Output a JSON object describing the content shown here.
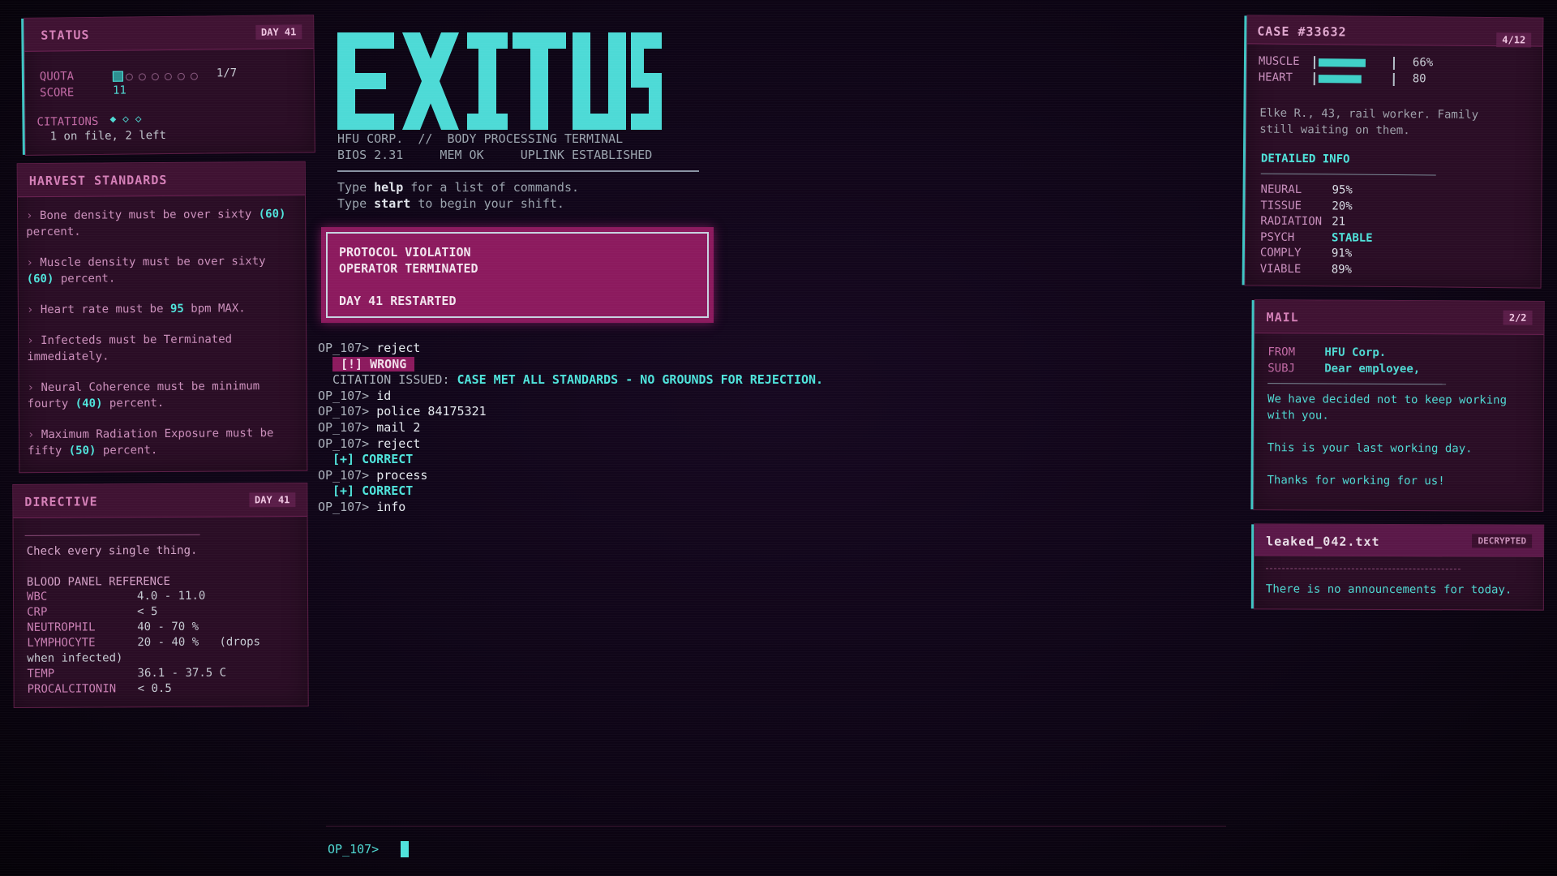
{
  "status": {
    "title": "STATUS",
    "day_badge": "DAY 41",
    "quota_label": "QUOTA",
    "quota_value": "1/7",
    "quota_progress": 1,
    "quota_total": 7,
    "score_label": "SCORE",
    "score_value": "11",
    "citations_label": "CITATIONS",
    "citations_icons": "◆ ◇ ◇",
    "citations_note": "1 on file, 2 left"
  },
  "harvest": {
    "title": "HARVEST STANDARDS",
    "rules": [
      [
        "Bone density must be over sixty ",
        "(60)",
        " percent."
      ],
      [
        "Muscle density must be over sixty ",
        "(60)",
        " percent."
      ],
      [
        "Heart rate must be ",
        "95",
        " bpm MAX."
      ],
      [
        "Infecteds must be Terminated immediately.",
        "",
        ""
      ],
      [
        "Neural Coherence must be minimum fourty ",
        "(40)",
        " percent."
      ],
      [
        "Maximum Radiation Exposure must be fifty ",
        "(50)",
        " percent."
      ]
    ]
  },
  "directive": {
    "title": "DIRECTIVE",
    "day_badge": "DAY 41",
    "message": "Check every single thing.",
    "ref_title": "BLOOD PANEL REFERENCE",
    "rows": [
      {
        "name": "WBC",
        "value": "4.0 - 11.0"
      },
      {
        "name": "CRP",
        "value": "< 5"
      },
      {
        "name": "NEUTROPHIL",
        "value": "40 - 70 %"
      },
      {
        "name": "LYMPHOCYTE",
        "value": "20 - 40 %   (drops"
      },
      {
        "name": "TEMP",
        "value": "36.1 - 37.5 C"
      },
      {
        "name": "PROCALCITONIN",
        "value": "< 0.5"
      }
    ],
    "wrap_note": "when infected)"
  },
  "terminal": {
    "logo": "EXITUS",
    "info_line1": "HFU CORP.  //  BODY PROCESSING TERMINAL",
    "info_line2": "BIOS 2.31     MEM OK     UPLINK ESTABLISHED",
    "help_pre": "Type ",
    "help_kw": "help",
    "help_post": " for a list of commands.",
    "start_pre": "Type ",
    "start_kw": "start",
    "start_post": " to begin your shift.",
    "alert_line1": "PROTOCOL VIOLATION",
    "alert_line2": "OPERATOR TERMINATED",
    "alert_line3": "DAY 41 RESTARTED",
    "prompt": "OP_107>",
    "log": [
      {
        "kind": "cmd",
        "text": "reject"
      },
      {
        "kind": "wrong",
        "text": "[!] WRONG"
      },
      {
        "kind": "citation",
        "pre": "CITATION ISSUED: ",
        "text": "CASE MET ALL STANDARDS - NO GROUNDS FOR REJECTION."
      },
      {
        "kind": "cmd",
        "text": "id"
      },
      {
        "kind": "cmd",
        "text": "police 84175321"
      },
      {
        "kind": "cmd",
        "text": "mail 2"
      },
      {
        "kind": "cmd",
        "text": "reject"
      },
      {
        "kind": "ok",
        "text": "[+] CORRECT"
      },
      {
        "kind": "cmd",
        "text": "process"
      },
      {
        "kind": "ok",
        "text": "[+] CORRECT"
      },
      {
        "kind": "cmd",
        "text": "info"
      }
    ]
  },
  "case": {
    "title": "CASE #33632",
    "badge": "4/12",
    "bars": [
      {
        "label": "MUSCLE",
        "value": "66%",
        "fill": 0.66
      },
      {
        "label": "HEART",
        "value": "80",
        "fill": 0.6
      }
    ],
    "bio": "Elke R., 43, rail worker. Family still waiting on them.",
    "detail_title": "DETAILED INFO",
    "details": [
      {
        "name": "NEURAL",
        "value": "95%"
      },
      {
        "name": "TISSUE",
        "value": "20%"
      },
      {
        "name": "RADIATION",
        "value": "21"
      },
      {
        "name": "PSYCH",
        "value": "STABLE"
      },
      {
        "name": "COMPLY",
        "value": "91%"
      },
      {
        "name": "VIABLE",
        "value": "89%"
      }
    ]
  },
  "mail": {
    "title": "MAIL",
    "badge": "2/2",
    "from_label": "FROM",
    "from_value": "HFU Corp.",
    "subj_label": "SUBJ",
    "subj_value": "Dear employee,",
    "body": [
      "We have decided not to keep working",
      "with you.",
      "This is your last working day.",
      "Thanks for working for us!"
    ]
  },
  "leak": {
    "filename": "leaked_042.txt",
    "badge": "DECRYPTED",
    "text": "There is no announcements for today."
  },
  "colors": {
    "panel": "#2a0d25",
    "header": "#3f1232",
    "accent_cyan": "#4fe3db",
    "accent_pink": "#d47fb7",
    "alert": "#a01d6c"
  }
}
